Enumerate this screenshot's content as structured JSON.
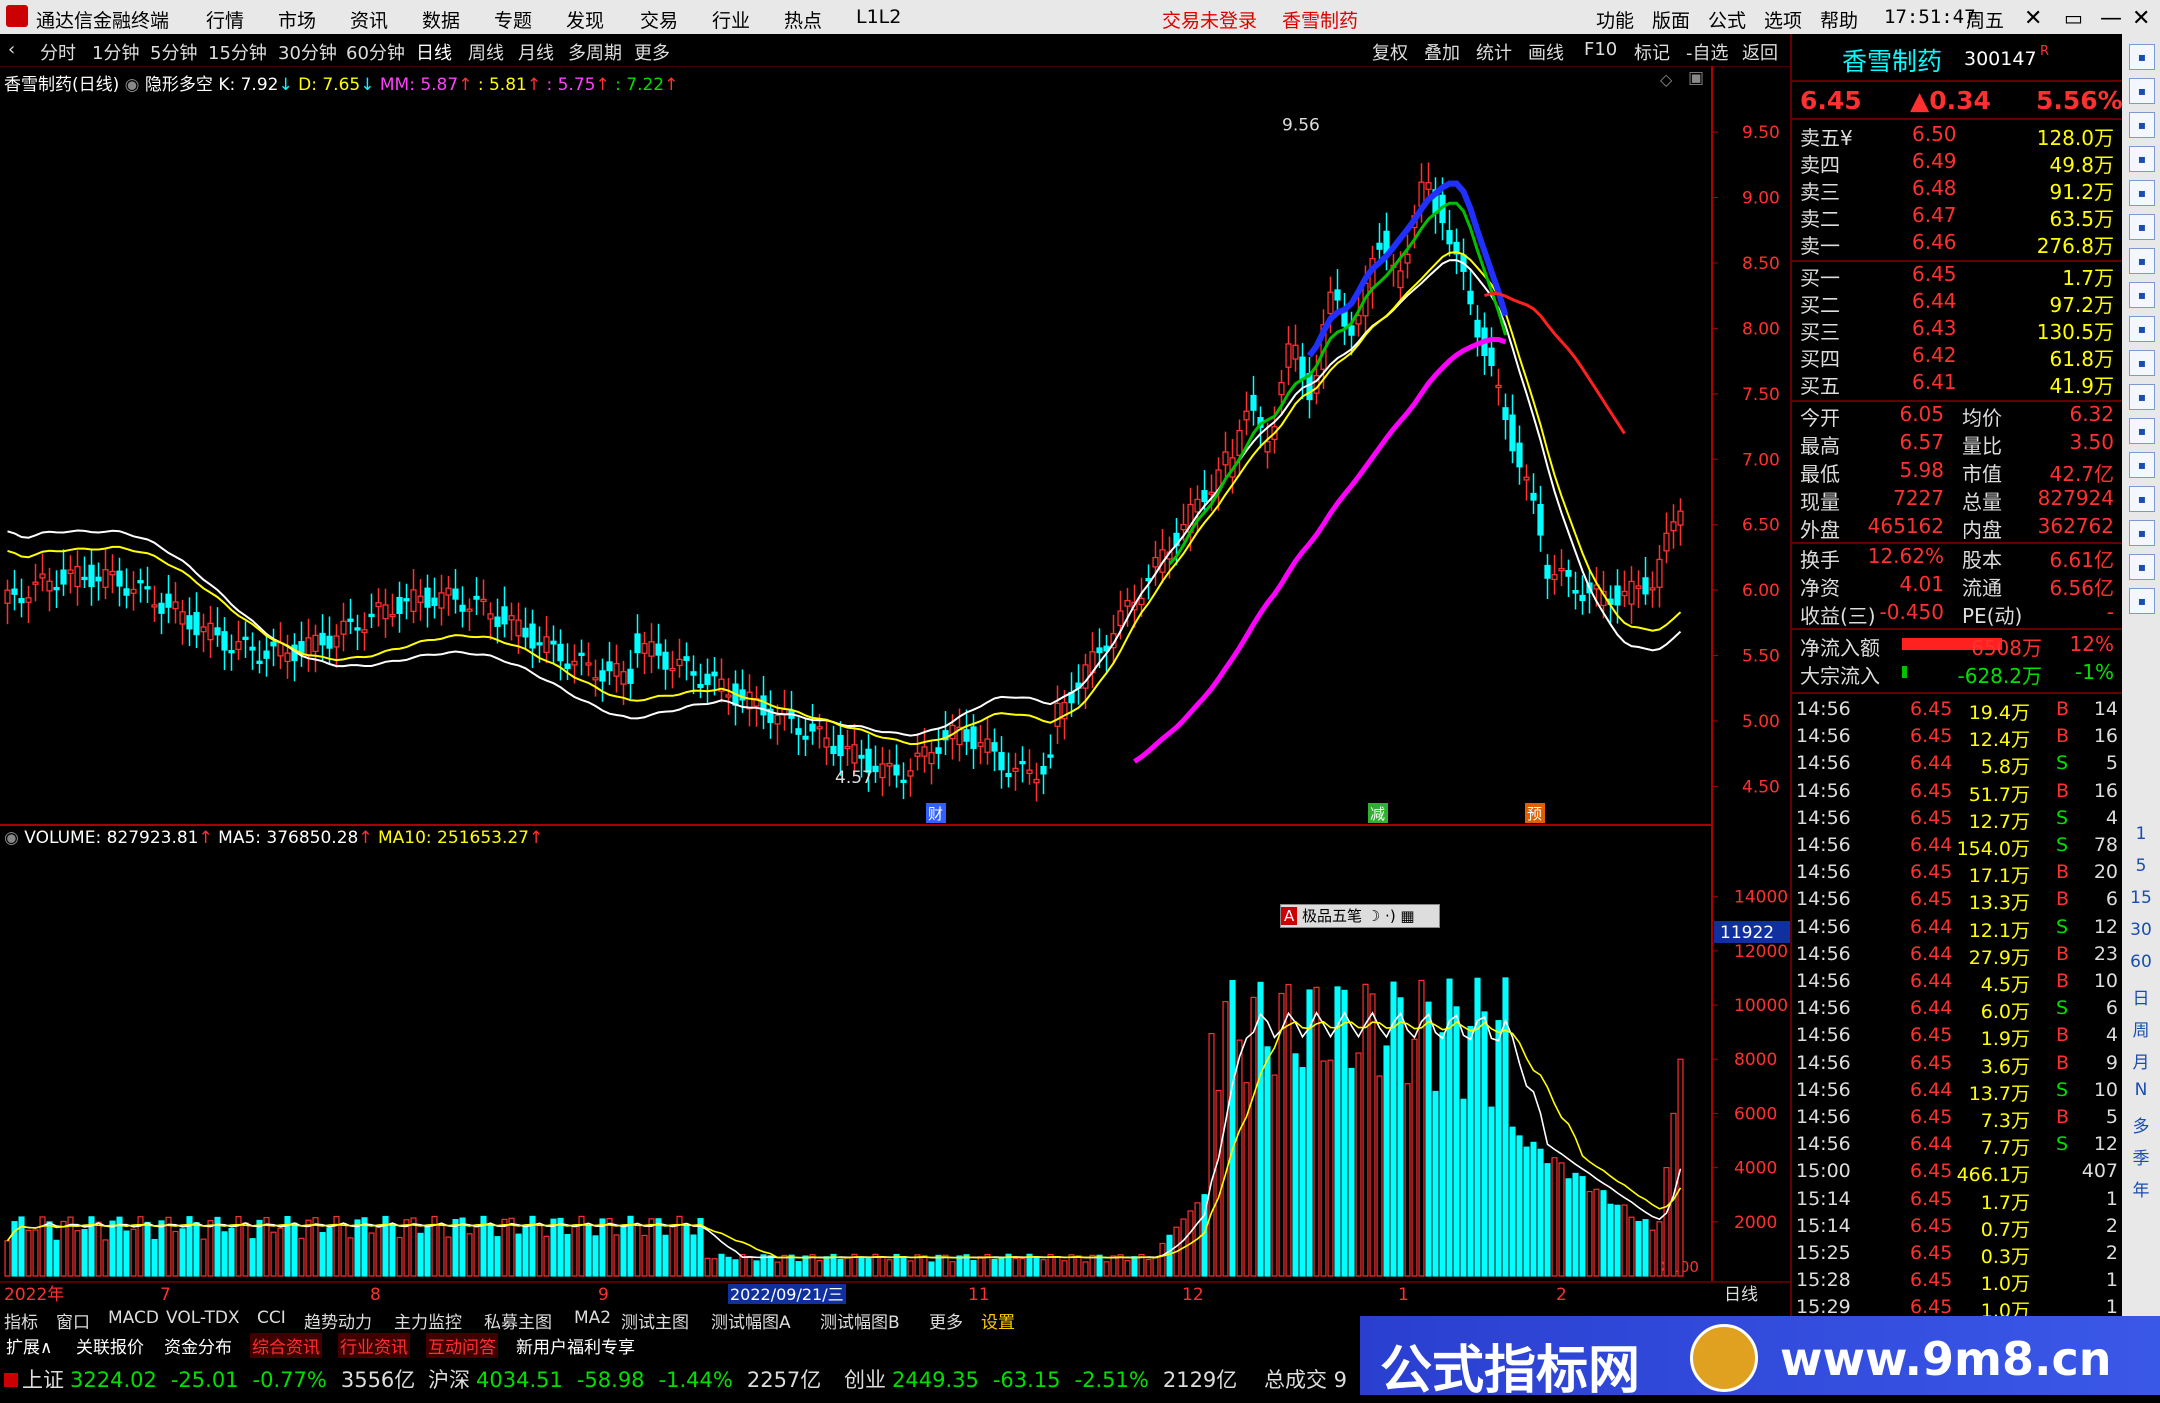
{
  "titlebar": {
    "app_name": "通达信金融终端",
    "menus": [
      "行情",
      "市场",
      "资讯",
      "数据",
      "专题",
      "发现",
      "交易",
      "行业",
      "热点",
      "L1L2"
    ],
    "status_login": "交易未登录",
    "stock_name": "香雪制药",
    "right_menus": [
      "功能",
      "版面",
      "公式",
      "选项",
      "帮助"
    ],
    "time": "17:51:47",
    "weekday": "周五"
  },
  "toolbar": {
    "periods": [
      "分时",
      "1分钟",
      "5分钟",
      "15分钟",
      "30分钟",
      "60分钟",
      "日线",
      "周线",
      "月线",
      "多周期",
      "更多"
    ],
    "active_period": "日线",
    "right_buttons": [
      "复权",
      "叠加",
      "统计",
      "画线",
      "F10",
      "标记",
      "-自选",
      "返回"
    ]
  },
  "main_legend": {
    "title": "香雪制药(日线)",
    "indicator": "隐形多空",
    "k": "K: 7.92",
    "d": "D: 7.65",
    "mm": "MM: 5.87",
    "v1": ": 5.81",
    "v2": ": 5.75",
    "v3": ": 7.22"
  },
  "main_axis": {
    "ticks": [
      "9.50",
      "9.00",
      "8.50",
      "8.00",
      "7.50",
      "7.00",
      "6.50",
      "6.00",
      "5.50",
      "5.00",
      "4.50"
    ],
    "high_label": "9.56",
    "low_label": "4.57",
    "markers": [
      "财",
      "减",
      "预"
    ]
  },
  "vol_legend": {
    "volume": "VOLUME: 827923.81",
    "ma5": "MA5: 376850.28",
    "ma10": "MA10: 251653.27"
  },
  "vol_axis": {
    "ticks": [
      "14000",
      "12000",
      "10000",
      "8000",
      "6000",
      "4000",
      "2000"
    ],
    "cursor_value": "11922",
    "unit": "X100"
  },
  "date_axis": [
    "2022年",
    "7",
    "8",
    "9",
    "2022/09/21/三",
    "11",
    "12",
    "1",
    "2"
  ],
  "date_axis_period": "日线",
  "floating_tool": "极品五笔",
  "panel": {
    "name": "香雪制药",
    "code": "300147",
    "code_mark": "R",
    "price": "6.45",
    "change": "▲0.34",
    "change_pct": "5.56%",
    "asks": [
      {
        "label": "卖五¥",
        "price": "6.50",
        "vol": "128.0万"
      },
      {
        "label": "卖四",
        "price": "6.49",
        "vol": "49.8万"
      },
      {
        "label": "卖三",
        "price": "6.48",
        "vol": "91.2万"
      },
      {
        "label": "卖二",
        "price": "6.47",
        "vol": "63.5万"
      },
      {
        "label": "卖一",
        "price": "6.46",
        "vol": "276.8万"
      }
    ],
    "bids": [
      {
        "label": "买一",
        "price": "6.45",
        "vol": "1.7万"
      },
      {
        "label": "买二",
        "price": "6.44",
        "vol": "97.2万"
      },
      {
        "label": "买三",
        "price": "6.43",
        "vol": "130.5万"
      },
      {
        "label": "买四",
        "price": "6.42",
        "vol": "61.8万"
      },
      {
        "label": "买五",
        "price": "6.41",
        "vol": "41.9万"
      }
    ],
    "stats1": [
      {
        "l1": "今开",
        "v1": "6.05",
        "l2": "均价",
        "v2": "6.32"
      },
      {
        "l1": "最高",
        "v1": "6.57",
        "l2": "量比",
        "v2": "3.50"
      },
      {
        "l1": "最低",
        "v1": "5.98",
        "l2": "市值",
        "v2": "42.7亿"
      },
      {
        "l1": "现量",
        "v1": "7227",
        "l2": "总量",
        "v2": "827924"
      },
      {
        "l1": "外盘",
        "v1": "465162",
        "l2": "内盘",
        "v2": "362762"
      }
    ],
    "stats2": [
      {
        "l1": "换手",
        "v1": "12.62%",
        "l2": "股本",
        "v2": "6.61亿"
      },
      {
        "l1": "净资",
        "v1": "4.01",
        "l2": "流通",
        "v2": "6.56亿"
      },
      {
        "l1": "收益(三)",
        "v1": "-0.450",
        "l2": "PE(动)",
        "v2": "-"
      }
    ],
    "flows": [
      {
        "label": "净流入额",
        "value": "6508万",
        "pct": "12%"
      },
      {
        "label": "大宗流入",
        "value": "-628.2万",
        "pct": "-1%"
      }
    ],
    "ticks": [
      {
        "t": "14:56",
        "p": "6.45",
        "v": "19.4万",
        "s": "B",
        "n": "14"
      },
      {
        "t": "14:56",
        "p": "6.45",
        "v": "12.4万",
        "s": "B",
        "n": "16"
      },
      {
        "t": "14:56",
        "p": "6.44",
        "v": "5.8万",
        "s": "S",
        "n": "5"
      },
      {
        "t": "14:56",
        "p": "6.45",
        "v": "51.7万",
        "s": "B",
        "n": "16"
      },
      {
        "t": "14:56",
        "p": "6.45",
        "v": "12.7万",
        "s": "S",
        "n": "4"
      },
      {
        "t": "14:56",
        "p": "6.44",
        "v": "154.0万",
        "s": "S",
        "n": "78"
      },
      {
        "t": "14:56",
        "p": "6.45",
        "v": "17.1万",
        "s": "B",
        "n": "20"
      },
      {
        "t": "14:56",
        "p": "6.45",
        "v": "13.3万",
        "s": "B",
        "n": "6"
      },
      {
        "t": "14:56",
        "p": "6.44",
        "v": "12.1万",
        "s": "S",
        "n": "12"
      },
      {
        "t": "14:56",
        "p": "6.44",
        "v": "27.9万",
        "s": "B",
        "n": "23"
      },
      {
        "t": "14:56",
        "p": "6.44",
        "v": "4.5万",
        "s": "B",
        "n": "10"
      },
      {
        "t": "14:56",
        "p": "6.44",
        "v": "6.0万",
        "s": "S",
        "n": "6"
      },
      {
        "t": "14:56",
        "p": "6.45",
        "v": "1.9万",
        "s": "B",
        "n": "4"
      },
      {
        "t": "14:56",
        "p": "6.45",
        "v": "3.6万",
        "s": "B",
        "n": "9"
      },
      {
        "t": "14:56",
        "p": "6.44",
        "v": "13.7万",
        "s": "S",
        "n": "10"
      },
      {
        "t": "14:56",
        "p": "6.45",
        "v": "7.3万",
        "s": "B",
        "n": "5"
      },
      {
        "t": "14:56",
        "p": "6.44",
        "v": "7.7万",
        "s": "S",
        "n": "12"
      },
      {
        "t": "15:00",
        "p": "6.45",
        "v": "466.1万",
        "s": "",
        "n": "407"
      },
      {
        "t": "15:14",
        "p": "6.45",
        "v": "1.7万",
        "s": "",
        "n": "1"
      },
      {
        "t": "15:14",
        "p": "6.45",
        "v": "0.7万",
        "s": "",
        "n": "2"
      },
      {
        "t": "15:25",
        "p": "6.45",
        "v": "0.3万",
        "s": "",
        "n": "2"
      },
      {
        "t": "15:28",
        "p": "6.45",
        "v": "1.0万",
        "s": "",
        "n": "1"
      },
      {
        "t": "15:29",
        "p": "6.45",
        "v": "1.0万",
        "s": "",
        "n": "1"
      }
    ]
  },
  "sidebar_labels": [
    "1",
    "5",
    "15",
    "30",
    "60",
    "日",
    "周",
    "月",
    "N",
    "多",
    "季",
    "年"
  ],
  "tabs": [
    "指标",
    "窗口",
    "MACD",
    "VOL-TDX",
    "CCI",
    "趋势动力",
    "主力监控",
    "私募主图",
    "MA2",
    "测试主图",
    "测试幅图A",
    "测试幅图B",
    "更多",
    "设置"
  ],
  "links": [
    "扩展∧",
    "关联报价",
    "资金分布",
    "综合资讯",
    "行业资讯",
    "互动问答",
    "新用户福利专享"
  ],
  "indices": [
    {
      "name": "上证",
      "value": "3224.02",
      "chg": "-25.01",
      "pct": "-0.77%",
      "amt": "3556亿"
    },
    {
      "name": "沪深",
      "value": "4034.51",
      "chg": "-58.98",
      "pct": "-1.44%",
      "amt": "2257亿"
    },
    {
      "name": "创业",
      "value": "2449.35",
      "chg": "-63.15",
      "pct": "-2.51%",
      "amt": "2129亿"
    }
  ],
  "index_tail": "总成交 9",
  "banner": {
    "left": "公式指标网",
    "right": "www.9m8.cn"
  },
  "chart_data": {
    "type": "bar",
    "title": "香雪制药(日线)",
    "categories": [
      "2022年",
      "7",
      "8",
      "9",
      "2022/09/21/三",
      "11",
      "12",
      "1",
      "2"
    ],
    "price_range": [
      4.57,
      9.56
    ],
    "last_close": 6.45,
    "volume_ylim": [
      0,
      14000
    ],
    "series": [
      {
        "name": "VOLUME",
        "values": [
          827923.81
        ]
      },
      {
        "name": "MA5",
        "values": [
          376850.28
        ]
      },
      {
        "name": "MA10",
        "values": [
          251653.27
        ]
      }
    ]
  },
  "colors": {
    "up": "#ff3030",
    "down": "#00ffff",
    "ma_white": "#ffffff",
    "ma_yellow": "#ffff00",
    "ma_magenta": "#ff00ff",
    "ma_green": "#00c000",
    "ma_blue": "#2030ff"
  }
}
